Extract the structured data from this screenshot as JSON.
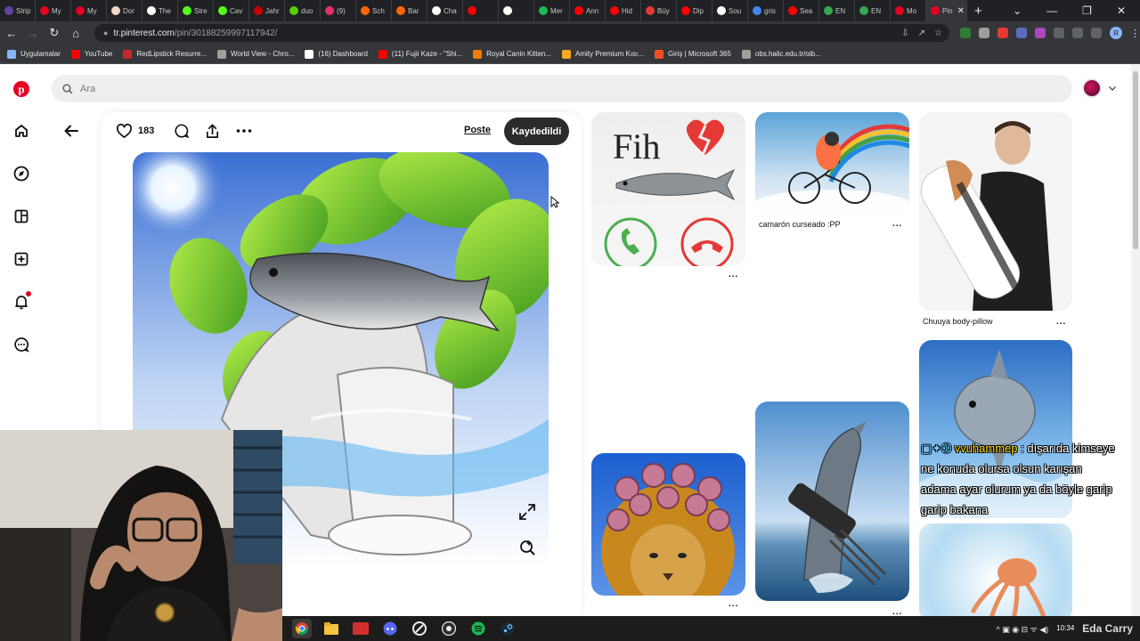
{
  "browser": {
    "tabs": [
      {
        "label": "Strip",
        "color": "#6441a5"
      },
      {
        "label": "My",
        "color": "#e60023"
      },
      {
        "label": "My",
        "color": "#e60023"
      },
      {
        "label": "Dor",
        "color": "#f1d6c3"
      },
      {
        "label": "The",
        "color": "#ffffff"
      },
      {
        "label": "Stre",
        "color": "#53fc18"
      },
      {
        "label": "Cav",
        "color": "#53fc18"
      },
      {
        "label": "Jahr",
        "color": "#cc0000"
      },
      {
        "label": "duo",
        "color": "#58cc02"
      },
      {
        "label": "(9)",
        "color": "#e1306c"
      },
      {
        "label": "Sch",
        "color": "#ff6600"
      },
      {
        "label": "Bar",
        "color": "#ff6600"
      },
      {
        "label": "Cha",
        "color": "#ffffff"
      },
      {
        "label": "",
        "color": "#ff0000"
      },
      {
        "label": "",
        "color": "#ffffff"
      },
      {
        "label": "Mer",
        "color": "#1db954"
      },
      {
        "label": "Ann",
        "color": "#ff0000"
      },
      {
        "label": "Hid",
        "color": "#ff0000"
      },
      {
        "label": "Büy",
        "color": "#e53935"
      },
      {
        "label": "Dip",
        "color": "#ff0000"
      },
      {
        "label": "Sou",
        "color": "#ffffff"
      },
      {
        "label": "gris",
        "color": "#4285f4"
      },
      {
        "label": "Sea",
        "color": "#ff0000"
      },
      {
        "label": "EN",
        "color": "#34a853"
      },
      {
        "label": "EN",
        "color": "#34a853"
      },
      {
        "label": "Mo",
        "color": "#e60023"
      },
      {
        "label": "Pin",
        "color": "#e60023"
      }
    ],
    "active_tab_close": "✕",
    "new_tab": "+",
    "window_controls": {
      "chevron": "⌄",
      "minimize": "—",
      "restore": "❐",
      "close": "✕"
    },
    "url_host": "tr.pinterest.com",
    "url_path": "/pin/30188259997117942/",
    "profile_initial": "R",
    "bookmarks": [
      {
        "label": "Uygulamalar",
        "color": "#8ab4f8"
      },
      {
        "label": "YouTube",
        "color": "#ff0000"
      },
      {
        "label": "RedLipstick Resurre...",
        "color": "#c62828"
      },
      {
        "label": "World View - Chro...",
        "color": "#9e9e9e"
      },
      {
        "label": "(16) Dashboard",
        "color": "#ffffff"
      },
      {
        "label": "(11) Fujii Kaze - \"Shi...",
        "color": "#ff0000"
      },
      {
        "label": "Royal Canin Kitten...",
        "color": "#f57c00"
      },
      {
        "label": "Amity Premium Kısı...",
        "color": "#f9a825"
      },
      {
        "label": "Giriş | Microsoft 365",
        "color": "#f25022"
      },
      {
        "label": "obs.halic.edu.tr/oib...",
        "color": "#9e9e9e"
      }
    ]
  },
  "pinterest": {
    "search_placeholder": "Ara",
    "pin": {
      "like_count": "183",
      "profile_link": "Poste",
      "save_label": "Kaydedildi"
    },
    "grid_captions": {
      "shrimp": "camarón curseado :PP",
      "body_pillow": "Chuuya body-pillow",
      "more": "..."
    },
    "tile_texts": {
      "fih": "Fih"
    }
  },
  "stream_chat": {
    "username": "vvuhammep",
    "separator": " : ",
    "message": "dışarıda kimseye ne konuda olursa olsun karışan adama ayar olurum ya da böyle garip garip bakana"
  },
  "taskbar": {
    "clock_time": "10:34",
    "tray_glyphs": "^ ▣ ◉ ⊟ ᯤ ◀)",
    "watermark": "Eda Carry"
  }
}
